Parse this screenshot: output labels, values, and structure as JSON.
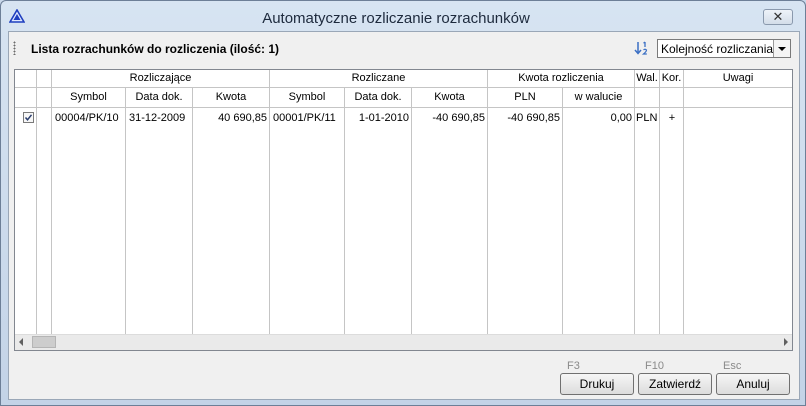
{
  "window": {
    "title": "Automatyczne rozliczanie rozrachunków",
    "close_label": "✕"
  },
  "toolbar": {
    "list_title": "Lista rozrachunków do rozliczenia (ilość: 1)",
    "order_select": {
      "selected": "Kolejność rozliczania"
    }
  },
  "table": {
    "groups": {
      "settling": "Rozliczające",
      "settled": "Rozliczane",
      "amount": "Kwota rozliczenia",
      "currency": "Wal.",
      "correction": "Kor.",
      "notes": "Uwagi"
    },
    "subheaders": {
      "settling_symbol": "Symbol",
      "settling_date": "Data dok.",
      "settling_amount": "Kwota",
      "settled_symbol": "Symbol",
      "settled_date": "Data dok.",
      "settled_amount": "Kwota",
      "amount_pln": "PLN",
      "amount_currency": "w walucie"
    },
    "rows": [
      {
        "checked": true,
        "settling_symbol": "00004/PK/10",
        "settling_date": "31-12-2009",
        "settling_amount": "40 690,85",
        "settled_symbol": "00001/PK/11",
        "settled_date": "1-01-2010",
        "settled_amount": "-40 690,85",
        "amount_pln": "-40 690,85",
        "amount_currency": "0,00",
        "currency": "PLN",
        "correction": "+",
        "notes": ""
      }
    ]
  },
  "buttons": {
    "print": {
      "label": "Drukuj",
      "shortcut": "F3"
    },
    "confirm": {
      "label": "Zatwierdź",
      "shortcut": "F10"
    },
    "cancel": {
      "label": "Anuluj",
      "shortcut": "Esc"
    }
  },
  "colors": {
    "accent": "#1f3fbf",
    "grid_line": "#c5c5c5"
  }
}
